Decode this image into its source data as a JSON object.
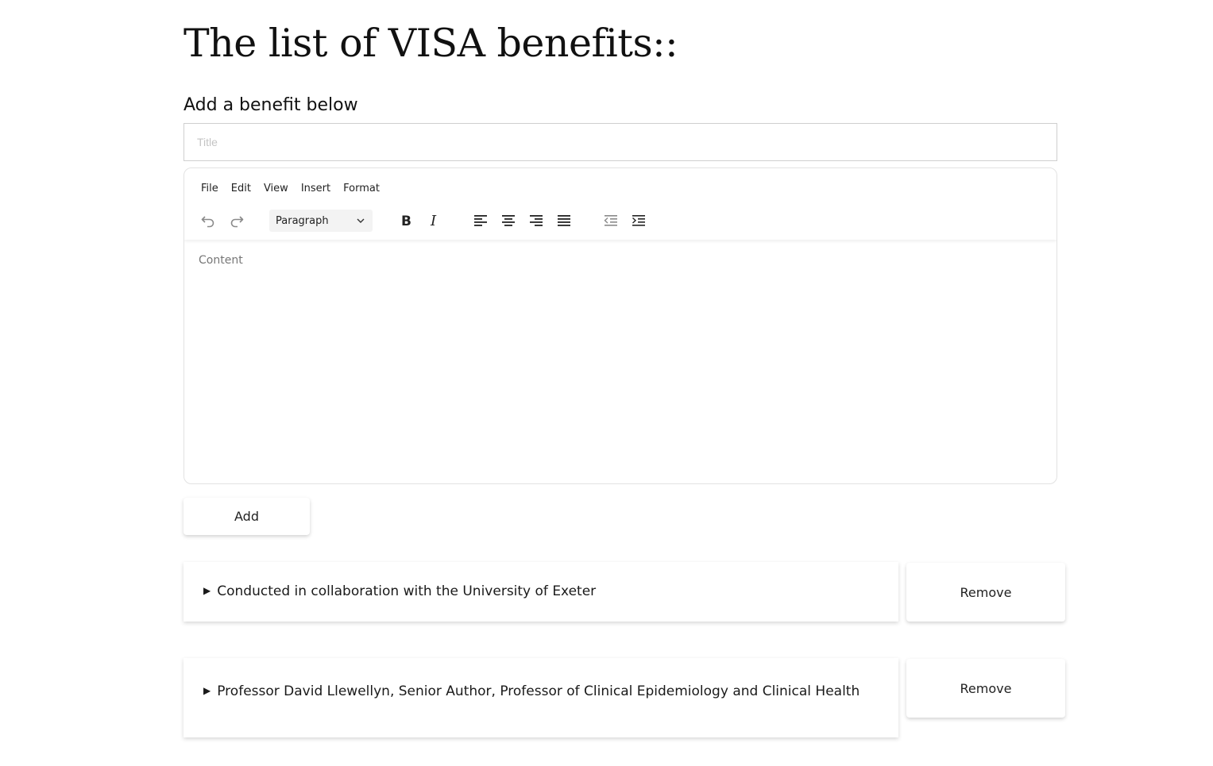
{
  "page": {
    "title": "The list of VISA benefits::",
    "subheading": "Add a benefit below"
  },
  "form": {
    "title_placeholder": "Title",
    "title_value": "",
    "add_label": "Add"
  },
  "editor": {
    "menu": [
      "File",
      "Edit",
      "View",
      "Insert",
      "Format"
    ],
    "block_format": "Paragraph",
    "content_placeholder": "Content",
    "toolbar_icons": [
      "undo-icon",
      "redo-icon",
      "bold-icon",
      "italic-icon",
      "align-left-icon",
      "align-center-icon",
      "align-right-icon",
      "align-justify-icon",
      "outdent-icon",
      "indent-icon"
    ]
  },
  "benefits": [
    {
      "marker": "▶",
      "title": "Conducted in collaboration with the University of Exeter",
      "remove_label": "Remove"
    },
    {
      "marker": "▶",
      "title": "Professor David Llewellyn, Senior Author, Professor of Clinical Epidemiology and Clinical Health",
      "remove_label": "Remove"
    }
  ],
  "colors": {
    "text": "#111111",
    "border": "#cfcfcf",
    "placeholder": "#c4c4c4",
    "disabled_icon": "#8a8a8a"
  }
}
